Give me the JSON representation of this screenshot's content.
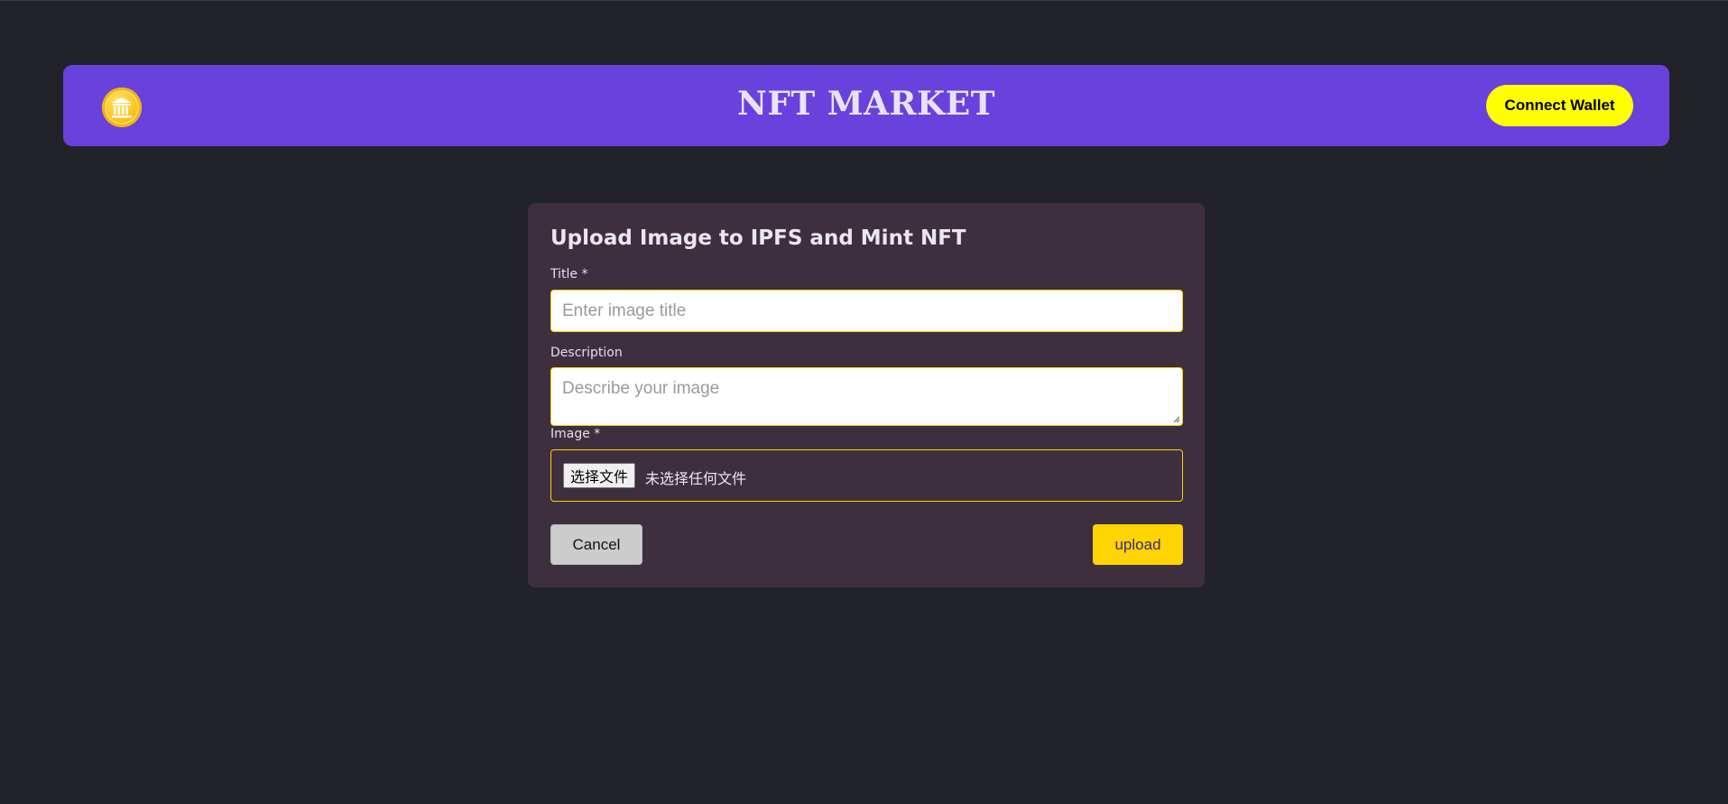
{
  "header": {
    "logo_icon": "bank-coin-icon",
    "brand": "NFT MARKET",
    "connect_label": "Connect Wallet"
  },
  "form": {
    "title": "Upload Image to IPFS and Mint NFT",
    "title_label": "Title *",
    "title_placeholder": "Enter image title",
    "title_value": "",
    "description_label": "Description",
    "description_placeholder": "Describe your image",
    "description_value": "",
    "image_label": "Image *",
    "file_button": "选择文件",
    "file_status": "未选择任何文件",
    "cancel_label": "Cancel",
    "upload_label": "upload"
  },
  "colors": {
    "background": "#212328",
    "navbar": "#6941dc",
    "card": "#3e2f3f",
    "accent_yellow": "#ffd400",
    "connect_yellow": "#ffff00"
  }
}
